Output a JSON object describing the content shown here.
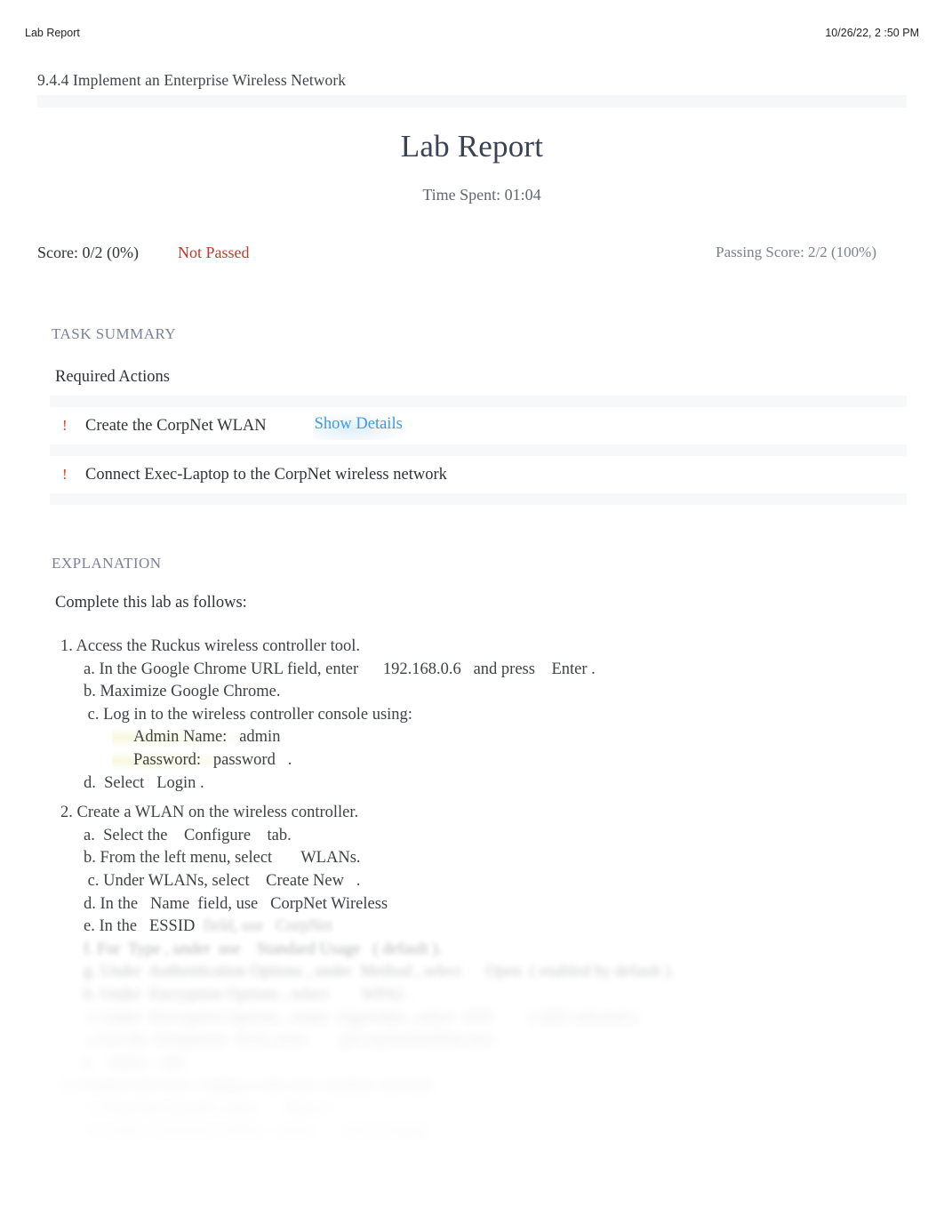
{
  "print_header": {
    "doc_title": "Lab Report",
    "timestamp": "10/26/22, 2  :50 PM"
  },
  "breadcrumb": "9.4.4 Implement an Enterprise Wireless Network",
  "report": {
    "title": "Lab Report",
    "time_spent_label": "Time Spent: 01:04",
    "score_label": "Score: 0/2 (0%)",
    "status_label": "Not Passed",
    "passing_score_label": "Passing Score: 2/2 (100%)"
  },
  "task_summary": {
    "heading": "TASK SUMMARY",
    "subheading": "Required Actions",
    "marker": "!",
    "items": [
      {
        "label": "Create the CorpNet WLAN",
        "link": "Show Details"
      },
      {
        "label": "Connect Exec-Laptop to the CorpNet wireless network",
        "link": ""
      }
    ]
  },
  "explanation": {
    "heading": "EXPLANATION",
    "intro": "Complete this lab as follows:",
    "steps": [
      {
        "text": "1. Access the Ruckus wireless controller tool.",
        "indent": "step",
        "fade": "fade-0"
      },
      {
        "text": "a. In the Google Chrome URL field, enter      192.168.0.6   and press    Enter .",
        "indent": "sub",
        "fade": "fade-0"
      },
      {
        "text": "b. Maximize Google Chrome.",
        "indent": "sub",
        "fade": "fade-0"
      },
      {
        "text": " c. Log in to the wireless controller console using:",
        "indent": "sub",
        "fade": "fade-0"
      },
      {
        "text": "Admin Name:   admin",
        "indent": "subsub",
        "fade": "fade-0",
        "highlight": true
      },
      {
        "text": "Password:   password   .",
        "indent": "subsub",
        "fade": "fade-0",
        "highlight": true
      },
      {
        "text": "d.  Select   Login .",
        "indent": "sub",
        "fade": "fade-0"
      },
      {
        "text": "2. Create a WLAN on the wireless controller.",
        "indent": "step",
        "fade": "fade-0"
      },
      {
        "text": "a.  Select the    Configure    tab.",
        "indent": "sub",
        "fade": "fade-0"
      },
      {
        "text": "b. From the left menu, select       WLANs.",
        "indent": "sub",
        "fade": "fade-0"
      },
      {
        "text": " c. Under WLANs, select    Create New   .",
        "indent": "sub",
        "fade": "fade-0"
      },
      {
        "text": "d. In the   Name  field, use   CorpNet Wireless",
        "indent": "sub",
        "fade": "fade-0"
      },
      {
        "text": "e. In the   ESSID",
        "indent": "sub",
        "fade": "fade-0",
        "blur_tail": "  field, use   CorpNet"
      },
      {
        "text": "f. For  Type , under  use    Standard Usage   ( default ).",
        "indent": "sub",
        "fade": "fade-1"
      },
      {
        "text": "g. Under  Authentication Options , under  Method , select      Open  ( enabled by default ).",
        "indent": "sub",
        "fade": "fade-2"
      },
      {
        "text": "h. Under  Encryption Options , select        WPA2 .",
        "indent": "sub",
        "fade": "fade-3"
      },
      {
        "text": " i. Under  Encryption Options , under  Algorithm , select  AES         ( AES selected ).",
        "indent": "sub",
        "fade": "fade-5"
      },
      {
        "text": " j. For the  Passphrase  field, enter        @CorpNetWeRSecure!  .",
        "indent": "sub",
        "fade": "fade-6"
      },
      {
        "text": "k.   Select   OK .",
        "indent": "sub",
        "fade": "fade-7"
      },
      {
        "text": "3. Connect the Exec-Laptop to the new wireless network.",
        "indent": "step",
        "fade": "fade-8"
      },
      {
        "text": " a. From the top left, select      Floor 1 .",
        "indent": "sub",
        "fade": "fade-9"
      },
      {
        "text": " b. Under  Executive Office , select       Exec-Laptop .",
        "indent": "sub",
        "fade": "fade-10"
      }
    ]
  },
  "colors": {
    "accent_link": "#3d9ae8",
    "status_fail": "#bf3b2b",
    "marker_red": "#e23b2b",
    "section_heading": "#7b8194",
    "muted_text": "#7c828b",
    "band": "#f6f7f8"
  }
}
